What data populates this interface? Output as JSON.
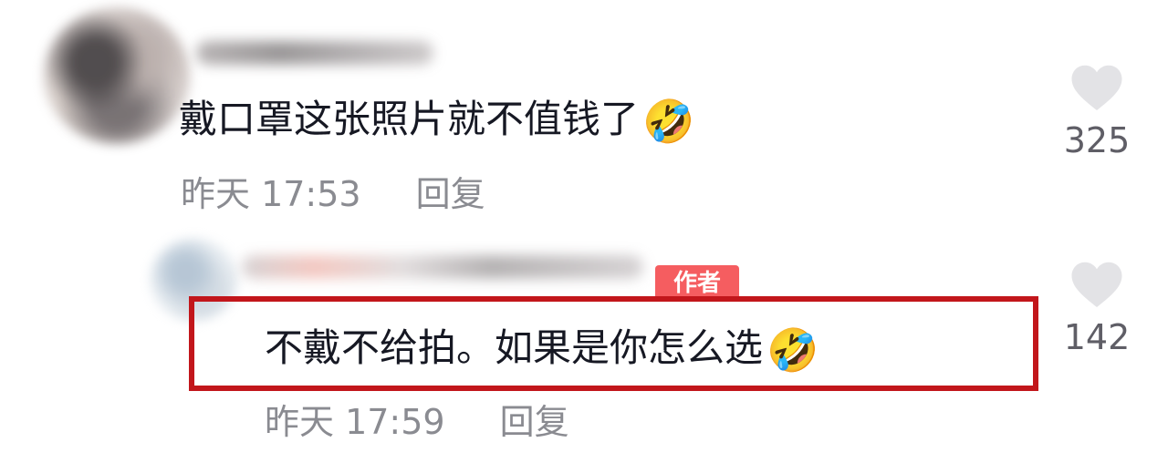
{
  "comments": [
    {
      "text": "戴口罩这张照片就不值钱了",
      "emoji": "🤣",
      "timestamp": "昨天 17:53",
      "reply_label": "回复",
      "likes": "325"
    },
    {
      "badge": "作者",
      "text": "不戴不给拍。如果是你怎么选",
      "emoji": "🤣",
      "timestamp": "昨天 17:59",
      "reply_label": "回复",
      "likes": "142"
    }
  ],
  "colors": {
    "highlight_border": "#c2161b",
    "author_badge": "#f55d60",
    "heart": "#e3e3e6",
    "meta_text": "#8a8b91"
  },
  "icons": {
    "like": "heart-icon",
    "emoji": "rolling-on-floor-laughing"
  }
}
